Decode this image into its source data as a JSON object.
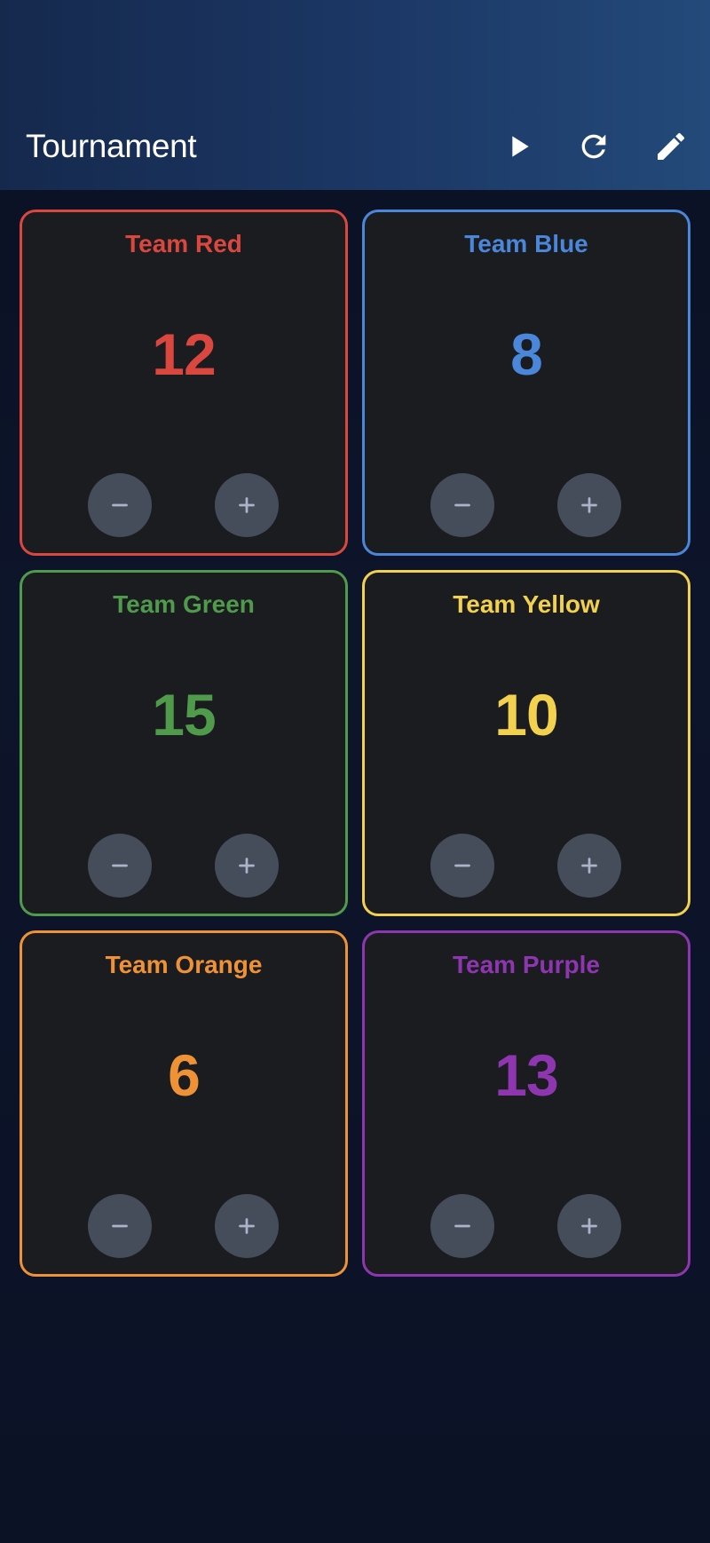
{
  "app": {
    "title": "Tournament"
  },
  "toolbar": {
    "play_icon": "play-icon",
    "reset_icon": "refresh-icon",
    "edit_icon": "pencil-icon"
  },
  "teams": [
    {
      "name": "Team Red",
      "score": "12",
      "color": "#d9473f"
    },
    {
      "name": "Team Blue",
      "score": "8",
      "color": "#4a86d9"
    },
    {
      "name": "Team Green",
      "score": "15",
      "color": "#4f9a4b"
    },
    {
      "name": "Team Yellow",
      "score": "10",
      "color": "#f2d14e"
    },
    {
      "name": "Team Orange",
      "score": "6",
      "color": "#ef9236"
    },
    {
      "name": "Team Purple",
      "score": "13",
      "color": "#8d36b0"
    }
  ],
  "controls": {
    "decrement_icon": "minus-icon",
    "increment_icon": "plus-icon",
    "button_bg": "#454d5b",
    "icon_color": "#aab3c7"
  }
}
